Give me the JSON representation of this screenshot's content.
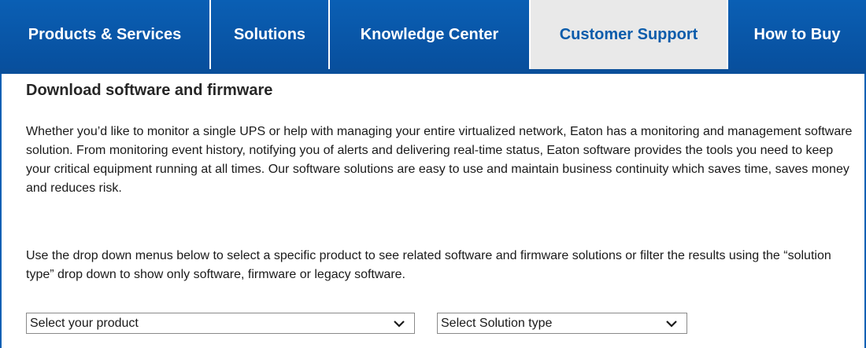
{
  "nav": {
    "tabs": [
      {
        "label": "Products & Services",
        "active": false
      },
      {
        "label": "Solutions",
        "active": false
      },
      {
        "label": "Knowledge Center",
        "active": false
      },
      {
        "label": "Customer Support",
        "active": true
      },
      {
        "label": "How to Buy",
        "active": false
      }
    ]
  },
  "main": {
    "title": "Download software and firmware",
    "paragraph1": "Whether you’d like to monitor a single UPS or help with managing your entire virtualized network, Eaton has a monitoring and management software solution. From monitoring event history, notifying you of alerts and delivering real-time status, Eaton software provides the tools you need to keep your critical equipment running at all times. Our software solutions are easy to use and maintain business continuity which saves time, saves money and reduces risk.",
    "paragraph2": "Use the drop down menus below to select a specific product to see related software and firmware solutions or filter the results using the “solution type” drop down to show only software, firmware or legacy software.",
    "product_select": {
      "value": "Select your product"
    },
    "solution_select": {
      "value": "Select Solution type"
    }
  },
  "colors": {
    "nav_blue": "#0a5fb4",
    "active_tab_bg": "#e9e9e9",
    "active_tab_text": "#0b5cab"
  }
}
